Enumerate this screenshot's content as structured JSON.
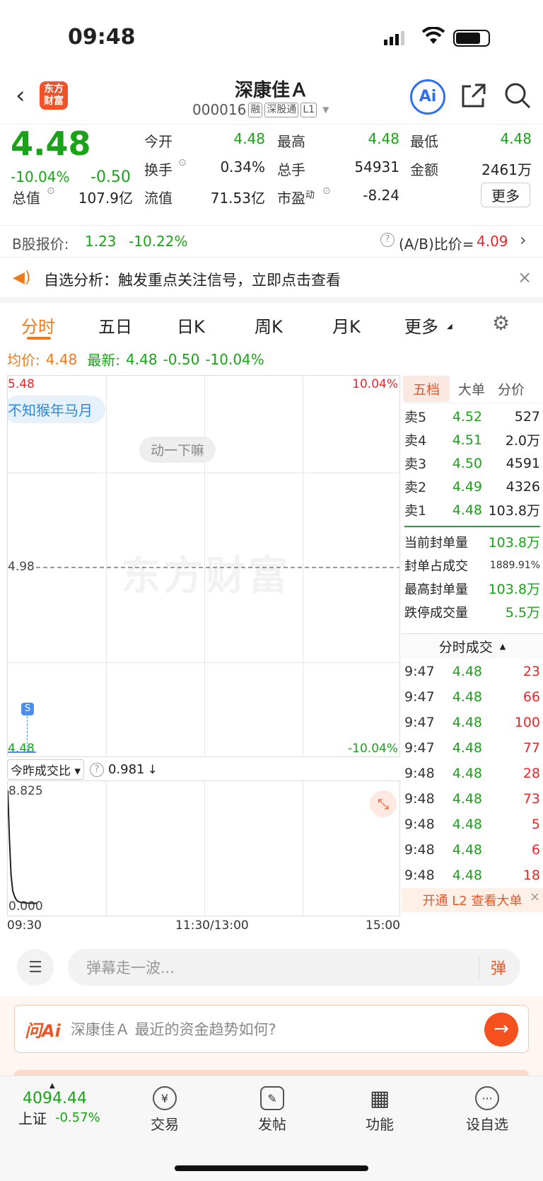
{
  "status": {
    "time": "09:48"
  },
  "header": {
    "logo_line1": "东方",
    "logo_line2": "财富",
    "title": "深康佳Ａ",
    "code": "000016",
    "tags": [
      "融",
      "深股通",
      "L1"
    ],
    "ai_label": "Ai"
  },
  "quote": {
    "price": "4.48",
    "change_pct": "-10.04%",
    "change": "-0.50",
    "open_label": "今开",
    "open": "4.48",
    "high_label": "最高",
    "high": "4.48",
    "low_label": "最低",
    "low": "4.48",
    "turnover_label": "换手",
    "turnover": "0.34%",
    "volume_label": "总手",
    "volume": "54931",
    "amount_label": "金额",
    "amount": "2461万",
    "mcap_label": "总值",
    "mcap": "107.9亿",
    "float_label": "流值",
    "float": "71.53亿",
    "pe_label": "市盈",
    "pe_sup": "动",
    "pe": "-8.24",
    "more": "更多"
  },
  "bshare": {
    "label": "B股报价:",
    "price": "1.23",
    "pct": "-10.22%",
    "ratio_label": "(A/B)比价=",
    "ratio": "4.09"
  },
  "banner": {
    "text": "自选分析：触发重点关注信号，立即点击查看"
  },
  "tabs": [
    "分时",
    "五日",
    "日K",
    "周K",
    "月K",
    "更多"
  ],
  "infoline": {
    "avg_label": "均价:",
    "avg": "4.48",
    "last_label": "最新:",
    "last": "4.48",
    "chg": "-0.50",
    "pct": "-10.04%"
  },
  "chart": {
    "top_price": "5.48",
    "top_pct": "10.04%",
    "mid_price": "4.98",
    "low_price": "4.48",
    "low_pct": "-10.04%",
    "danmu1": "不知猴年马月",
    "danmu2": "动一下嘛",
    "watermark": "东方财富",
    "marker": "S",
    "ratio_label": "今昨成交比",
    "ratio_value": "0.981",
    "vol_top": "8.825",
    "vol_bottom": "0.000",
    "time_start": "09:30",
    "time_mid": "11:30/13:00",
    "time_end": "15:00"
  },
  "chart_data": {
    "type": "line",
    "title": "",
    "xlabel": "",
    "ylabel": "",
    "x": [
      "09:30",
      "09:31",
      "09:32",
      "09:33",
      "09:34",
      "09:35",
      "09:36",
      "09:37",
      "09:38",
      "09:39",
      "09:40",
      "09:41",
      "09:42",
      "09:43",
      "09:44",
      "09:45",
      "09:46",
      "09:47",
      "09:48"
    ],
    "series": [
      {
        "values": [
          8.825,
          5.2,
          2.4,
          1.2,
          0.8,
          0.55,
          0.4,
          0.35,
          0.3,
          0.3,
          0.28,
          0.28,
          0.26,
          0.25,
          0.25,
          0.24,
          0.24,
          0.24,
          0.24
        ]
      }
    ],
    "ylim": [
      0,
      8.825
    ]
  },
  "orderbook": {
    "tabs": [
      "五档",
      "大单",
      "分价"
    ],
    "rows": [
      {
        "label": "卖5",
        "price": "4.52",
        "vol": "527"
      },
      {
        "label": "卖4",
        "price": "4.51",
        "vol": "2.0万"
      },
      {
        "label": "卖3",
        "price": "4.50",
        "vol": "4591"
      },
      {
        "label": "卖2",
        "price": "4.49",
        "vol": "4326"
      },
      {
        "label": "卖1",
        "price": "4.48",
        "vol": "103.8万"
      }
    ],
    "stats": [
      {
        "label": "当前封单量",
        "value": "103.8万"
      },
      {
        "label": "封单占成交",
        "value": "1889.91%"
      },
      {
        "label": "最高封单量",
        "value": "103.8万"
      },
      {
        "label": "跌停成交量",
        "value": "5.5万"
      }
    ]
  },
  "trades": {
    "title": "分时成交",
    "rows": [
      {
        "time": "9:47",
        "price": "4.48",
        "vol": "23"
      },
      {
        "time": "9:47",
        "price": "4.48",
        "vol": "66"
      },
      {
        "time": "9:47",
        "price": "4.48",
        "vol": "100"
      },
      {
        "time": "9:47",
        "price": "4.48",
        "vol": "77"
      },
      {
        "time": "9:48",
        "price": "4.48",
        "vol": "28"
      },
      {
        "time": "9:48",
        "price": "4.48",
        "vol": "73"
      },
      {
        "time": "9:48",
        "price": "4.48",
        "vol": "5"
      },
      {
        "time": "9:48",
        "price": "4.48",
        "vol": "6"
      },
      {
        "time": "9:48",
        "price": "4.48",
        "vol": "18"
      }
    ],
    "l2_promo": "开通 L2 查看大单"
  },
  "danmu_input": {
    "placeholder": "弹幕走一波...",
    "send": "弹"
  },
  "ask_ai": {
    "brand": "问Ai",
    "question": "深康佳Ａ 最近的资金趋势如何?"
  },
  "bottom_nav": {
    "index_value": "4094.44",
    "index_name": "上证",
    "index_pct": "-0.57%",
    "items": [
      "交易",
      "发帖",
      "功能",
      "设自选"
    ],
    "icons": [
      "¥",
      "✎",
      "▦",
      "···"
    ]
  }
}
